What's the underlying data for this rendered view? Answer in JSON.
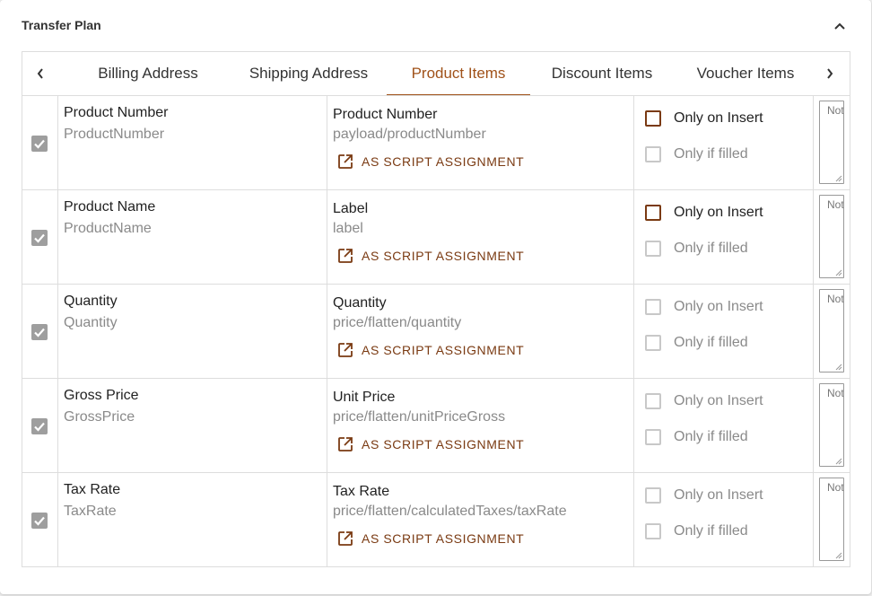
{
  "header": {
    "title": "Transfer Plan",
    "collapse_icon": "chevron-up-icon"
  },
  "tabs": [
    {
      "label": "Billing Address",
      "active": false
    },
    {
      "label": "Shipping Address",
      "active": false
    },
    {
      "label": "Product Items",
      "active": true
    },
    {
      "label": "Discount Items",
      "active": false
    },
    {
      "label": "Voucher Items",
      "active": false
    }
  ],
  "tab_nav": {
    "prev_icon": "chevron-left-icon",
    "next_icon": "chevron-right-icon"
  },
  "accent_color": "#a0521a",
  "rows": [
    {
      "enabled": true,
      "target_label": "Product Number",
      "target_key": "ProductNumber",
      "source_label": "Product Number",
      "source_path": "payload/productNumber",
      "script_label": "AS SCRIPT ASSIGNMENT",
      "only_on_insert_label": "Only on Insert",
      "only_on_insert_highlight": true,
      "only_if_filled_label": "Only if filled",
      "note_placeholder": "Notes"
    },
    {
      "enabled": true,
      "target_label": "Product Name",
      "target_key": "ProductName",
      "source_label": "Label",
      "source_path": "label",
      "script_label": "AS SCRIPT ASSIGNMENT",
      "only_on_insert_label": "Only on Insert",
      "only_on_insert_highlight": true,
      "only_if_filled_label": "Only if filled",
      "note_placeholder": "Notes"
    },
    {
      "enabled": true,
      "target_label": "Quantity",
      "target_key": "Quantity",
      "source_label": "Quantity",
      "source_path": "price/flatten/quantity",
      "script_label": "AS SCRIPT ASSIGNMENT",
      "only_on_insert_label": "Only on Insert",
      "only_on_insert_highlight": false,
      "only_if_filled_label": "Only if filled",
      "note_placeholder": "Notes"
    },
    {
      "enabled": true,
      "target_label": "Gross Price",
      "target_key": "GrossPrice",
      "source_label": "Unit Price",
      "source_path": "price/flatten/unitPriceGross",
      "script_label": "AS SCRIPT ASSIGNMENT",
      "only_on_insert_label": "Only on Insert",
      "only_on_insert_highlight": false,
      "only_if_filled_label": "Only if filled",
      "note_placeholder": "Notes"
    },
    {
      "enabled": true,
      "target_label": "Tax Rate",
      "target_key": "TaxRate",
      "source_label": "Tax Rate",
      "source_path": "price/flatten/calculatedTaxes/taxRate",
      "script_label": "AS SCRIPT ASSIGNMENT",
      "only_on_insert_label": "Only on Insert",
      "only_on_insert_highlight": false,
      "only_if_filled_label": "Only if filled",
      "note_placeholder": "Notes"
    }
  ]
}
